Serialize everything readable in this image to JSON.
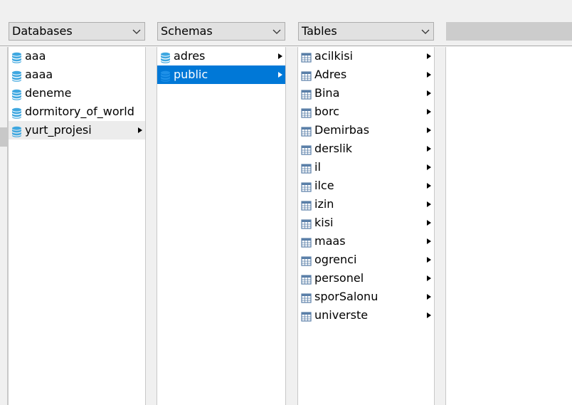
{
  "colors": {
    "selection": "#0078d7",
    "hover_row": "#ececec",
    "db_icon": "#3ea7e0",
    "table_icon": "#5a7fa8"
  },
  "combos": {
    "databases": {
      "label": "Databases"
    },
    "schemas": {
      "label": "Schemas"
    },
    "tables": {
      "label": "Tables"
    }
  },
  "databases": {
    "items": [
      {
        "label": "aaa",
        "icon": "database-icon"
      },
      {
        "label": "aaaa",
        "icon": "database-icon"
      },
      {
        "label": "deneme",
        "icon": "database-icon"
      },
      {
        "label": "dormitory_of_world",
        "icon": "database-icon"
      },
      {
        "label": "yurt_projesi",
        "icon": "database-icon",
        "state": "hover",
        "has_children": true
      }
    ]
  },
  "schemas": {
    "items": [
      {
        "label": "adres",
        "icon": "schema-icon",
        "has_children": true
      },
      {
        "label": "public",
        "icon": "schema-icon",
        "state": "selected",
        "has_children": true
      }
    ]
  },
  "tables": {
    "items": [
      {
        "label": "acilkisi",
        "icon": "table-icon",
        "has_children": true
      },
      {
        "label": "Adres",
        "icon": "table-icon",
        "has_children": true
      },
      {
        "label": "Bina",
        "icon": "table-icon",
        "has_children": true
      },
      {
        "label": "borc",
        "icon": "table-icon",
        "has_children": true
      },
      {
        "label": "Demirbas",
        "icon": "table-icon",
        "has_children": true
      },
      {
        "label": "derslik",
        "icon": "table-icon",
        "has_children": true
      },
      {
        "label": "il",
        "icon": "table-icon",
        "has_children": true
      },
      {
        "label": "ilce",
        "icon": "table-icon",
        "has_children": true
      },
      {
        "label": "izin",
        "icon": "table-icon",
        "has_children": true
      },
      {
        "label": "kisi",
        "icon": "table-icon",
        "has_children": true
      },
      {
        "label": "maas",
        "icon": "table-icon",
        "has_children": true
      },
      {
        "label": "ogrenci",
        "icon": "table-icon",
        "has_children": true
      },
      {
        "label": "personel",
        "icon": "table-icon",
        "has_children": true
      },
      {
        "label": "sporSalonu",
        "icon": "table-icon",
        "has_children": true
      },
      {
        "label": "universte",
        "icon": "table-icon",
        "has_children": true
      }
    ]
  }
}
